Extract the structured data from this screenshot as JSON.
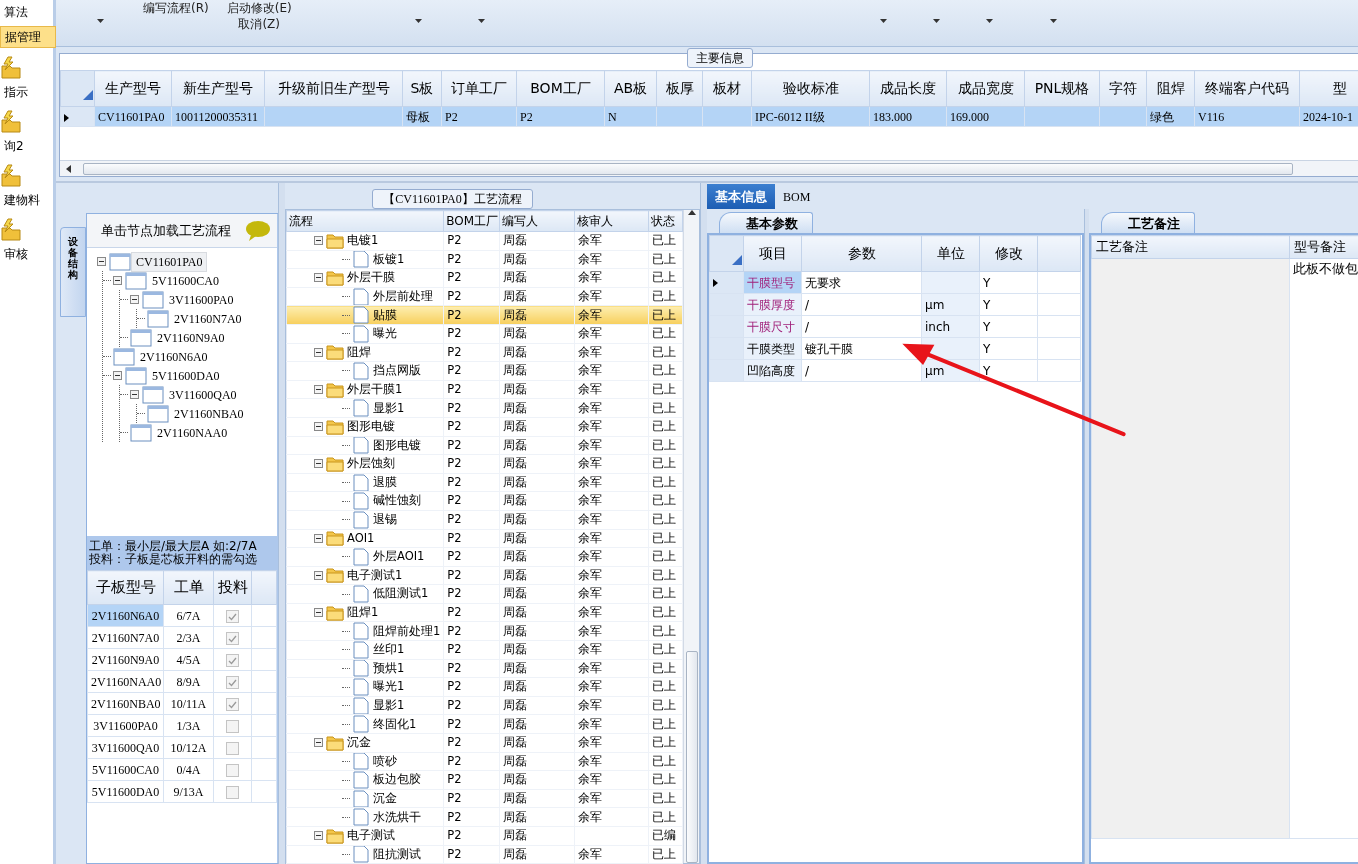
{
  "nav": [
    {
      "label": "算法",
      "kind": "text",
      "selected": false
    },
    {
      "label": "据管理",
      "kind": "text",
      "selected": true
    },
    {
      "label": "指示",
      "kind": "icon",
      "selected": false
    },
    {
      "label": "询2",
      "kind": "icon",
      "selected": false
    },
    {
      "label": "建物料",
      "kind": "icon",
      "selected": false
    },
    {
      "label": "审核",
      "kind": "icon",
      "selected": false
    }
  ],
  "toolbar": {
    "buttons": [
      {
        "label": "编写流程(R)"
      },
      {
        "label": "启动修改(E)"
      },
      {
        "label": "取消(Z)"
      }
    ]
  },
  "main_info": {
    "title": "主要信息",
    "columns": [
      "生产型号",
      "新生产型号",
      "升级前旧生产型号",
      "S板",
      "订单工厂",
      "BOM工厂",
      "AB板",
      "板厚",
      "板材",
      "验收标准",
      "成品长度",
      "成品宽度",
      "PNL规格",
      "字符",
      "阻焊",
      "终端客户代码",
      "型"
    ],
    "rows": [
      {
        "selected": true,
        "cells": [
          "CV11601PA0",
          "10011200035311",
          null,
          "母板",
          "P2",
          "P2",
          "N",
          null,
          null,
          "IPC-6012 II级",
          "183.000",
          "169.000",
          null,
          null,
          "绿色",
          "V116",
          "2024-10-1"
        ]
      }
    ]
  },
  "structure": {
    "side_tab": "设备结构",
    "hint": "单击节点加载工艺流程",
    "tree": [
      {
        "label": "CV11601PA0",
        "selected": true,
        "expanded": true,
        "children": [
          {
            "label": "5V11600CA0",
            "selected": false,
            "expanded": true,
            "children": [
              {
                "label": "3V11600PA0",
                "selected": false,
                "expanded": true,
                "children": [
                  {
                    "label": "2V1160N7A0",
                    "selected": false
                  }
                ]
              },
              {
                "label": "2V1160N9A0",
                "selected": false
              }
            ]
          },
          {
            "label": "2V1160N6A0",
            "selected": false
          },
          {
            "label": "5V11600DA0",
            "selected": false,
            "expanded": true,
            "children": [
              {
                "label": "3V11600QA0",
                "selected": false,
                "expanded": true,
                "children": [
                  {
                    "label": "2V1160NBA0",
                    "selected": false
                  }
                ]
              },
              {
                "label": "2V1160NAA0",
                "selected": false
              }
            ]
          }
        ]
      }
    ],
    "notes": [
      "工单：最小层/最大层A 如:2/7A",
      "投料：子板是芯板开料的需勾选"
    ],
    "columns": [
      "子板型号",
      "工单",
      "投料"
    ],
    "rows": [
      {
        "model": "2V1160N6A0",
        "order": "6/7A",
        "feed": true,
        "selected": true
      },
      {
        "model": "2V1160N7A0",
        "order": "2/3A",
        "feed": true,
        "selected": false
      },
      {
        "model": "2V1160N9A0",
        "order": "4/5A",
        "feed": true,
        "selected": false
      },
      {
        "model": "2V1160NAA0",
        "order": "8/9A",
        "feed": true,
        "selected": false
      },
      {
        "model": "2V1160NBA0",
        "order": "10/11A",
        "feed": true,
        "selected": false
      },
      {
        "model": "3V11600PA0",
        "order": "1/3A",
        "feed": false,
        "selected": false
      },
      {
        "model": "3V11600QA0",
        "order": "10/12A",
        "feed": false,
        "selected": false
      },
      {
        "model": "5V11600CA0",
        "order": "0/4A",
        "feed": false,
        "selected": false
      },
      {
        "model": "5V11600DA0",
        "order": "9/13A",
        "feed": false,
        "selected": false
      }
    ]
  },
  "flow": {
    "title": "【CV11601PA0】工艺流程",
    "columns": [
      "流程",
      "BOM工厂",
      "编写人",
      "核审人",
      "状态"
    ],
    "steps": [
      {
        "name": "电镀1",
        "bom": "P2",
        "writer": "周磊",
        "reviewer": "余军",
        "status": "已上",
        "selected": false,
        "children": [
          {
            "name": "板镀1",
            "bom": "P2",
            "writer": "周磊",
            "reviewer": "余军",
            "status": "已上",
            "selected": false
          }
        ]
      },
      {
        "name": "外层干膜",
        "bom": "P2",
        "writer": "周磊",
        "reviewer": "余军",
        "status": "已上",
        "selected": false,
        "children": [
          {
            "name": "外层前处理",
            "bom": "P2",
            "writer": "周磊",
            "reviewer": "余军",
            "status": "已上",
            "selected": false
          },
          {
            "name": "贴膜",
            "bom": "P2",
            "writer": "周磊",
            "reviewer": "余军",
            "status": "已上",
            "selected": true
          },
          {
            "name": "曝光",
            "bom": "P2",
            "writer": "周磊",
            "reviewer": "余军",
            "status": "已上",
            "selected": false
          }
        ]
      },
      {
        "name": "阻焊",
        "bom": "P2",
        "writer": "周磊",
        "reviewer": "余军",
        "status": "已上",
        "selected": false,
        "children": [
          {
            "name": "挡点网版",
            "bom": "P2",
            "writer": "周磊",
            "reviewer": "余军",
            "status": "已上",
            "selected": false
          }
        ]
      },
      {
        "name": "外层干膜1",
        "bom": "P2",
        "writer": "周磊",
        "reviewer": "余军",
        "status": "已上",
        "selected": false,
        "children": [
          {
            "name": "显影1",
            "bom": "P2",
            "writer": "周磊",
            "reviewer": "余军",
            "status": "已上",
            "selected": false
          }
        ]
      },
      {
        "name": "图形电镀",
        "bom": "P2",
        "writer": "周磊",
        "reviewer": "余军",
        "status": "已上",
        "selected": false,
        "children": [
          {
            "name": "图形电镀",
            "bom": "P2",
            "writer": "周磊",
            "reviewer": "余军",
            "status": "已上",
            "selected": false
          }
        ]
      },
      {
        "name": "外层蚀刻",
        "bom": "P2",
        "writer": "周磊",
        "reviewer": "余军",
        "status": "已上",
        "selected": false,
        "children": [
          {
            "name": "退膜",
            "bom": "P2",
            "writer": "周磊",
            "reviewer": "余军",
            "status": "已上",
            "selected": false
          },
          {
            "name": "碱性蚀刻",
            "bom": "P2",
            "writer": "周磊",
            "reviewer": "余军",
            "status": "已上",
            "selected": false
          },
          {
            "name": "退锡",
            "bom": "P2",
            "writer": "周磊",
            "reviewer": "余军",
            "status": "已上",
            "selected": false
          }
        ]
      },
      {
        "name": "AOI1",
        "bom": "P2",
        "writer": "周磊",
        "reviewer": "余军",
        "status": "已上",
        "selected": false,
        "children": [
          {
            "name": "外层AOI1",
            "bom": "P2",
            "writer": "周磊",
            "reviewer": "余军",
            "status": "已上",
            "selected": false
          }
        ]
      },
      {
        "name": "电子测试1",
        "bom": "P2",
        "writer": "周磊",
        "reviewer": "余军",
        "status": "已上",
        "selected": false,
        "children": [
          {
            "name": "低阻测试1",
            "bom": "P2",
            "writer": "周磊",
            "reviewer": "余军",
            "status": "已上",
            "selected": false
          }
        ]
      },
      {
        "name": "阻焊1",
        "bom": "P2",
        "writer": "周磊",
        "reviewer": "余军",
        "status": "已上",
        "selected": false,
        "children": [
          {
            "name": "阻焊前处理1",
            "bom": "P2",
            "writer": "周磊",
            "reviewer": "余军",
            "status": "已上",
            "selected": false
          },
          {
            "name": "丝印1",
            "bom": "P2",
            "writer": "周磊",
            "reviewer": "余军",
            "status": "已上",
            "selected": false
          },
          {
            "name": "预烘1",
            "bom": "P2",
            "writer": "周磊",
            "reviewer": "余军",
            "status": "已上",
            "selected": false
          },
          {
            "name": "曝光1",
            "bom": "P2",
            "writer": "周磊",
            "reviewer": "余军",
            "status": "已上",
            "selected": false
          },
          {
            "name": "显影1",
            "bom": "P2",
            "writer": "周磊",
            "reviewer": "余军",
            "status": "已上",
            "selected": false
          },
          {
            "name": "终固化1",
            "bom": "P2",
            "writer": "周磊",
            "reviewer": "余军",
            "status": "已上",
            "selected": false
          }
        ]
      },
      {
        "name": "沉金",
        "bom": "P2",
        "writer": "周磊",
        "reviewer": "余军",
        "status": "已上",
        "selected": false,
        "children": [
          {
            "name": "喷砂",
            "bom": "P2",
            "writer": "周磊",
            "reviewer": "余军",
            "status": "已上",
            "selected": false
          },
          {
            "name": "板边包胶",
            "bom": "P2",
            "writer": "周磊",
            "reviewer": "余军",
            "status": "已上",
            "selected": false
          },
          {
            "name": "沉金",
            "bom": "P2",
            "writer": "周磊",
            "reviewer": "余军",
            "status": "已上",
            "selected": false
          },
          {
            "name": "水洗烘干",
            "bom": "P2",
            "writer": "周磊",
            "reviewer": "余军",
            "status": "已上",
            "selected": false
          }
        ]
      },
      {
        "name": "电子测试",
        "bom": "P2",
        "writer": "周磊",
        "status": "已编",
        "selected": false,
        "children": [
          {
            "name": "阻抗测试",
            "bom": "P2",
            "writer": "周磊",
            "reviewer": "余军",
            "status": "已上",
            "selected": false
          }
        ]
      }
    ]
  },
  "detail": {
    "tabs": [
      {
        "label": "基本信息",
        "selected": true
      },
      {
        "label": "BOM",
        "selected": false
      }
    ],
    "params": {
      "tab": "基本参数",
      "columns": [
        "项目",
        "参数",
        "单位",
        "修改"
      ],
      "rows": [
        {
          "item": "干膜型号",
          "value": "无要求",
          "modify": "Y",
          "required": true,
          "selected": true
        },
        {
          "item": "干膜厚度",
          "value": "/",
          "unit": "μm",
          "modify": "Y",
          "required": true,
          "selected": false
        },
        {
          "item": "干膜尺寸",
          "value": "/",
          "unit": "inch",
          "modify": "Y",
          "required": true,
          "selected": false
        },
        {
          "item": "干膜类型",
          "value": "镀孔干膜",
          "modify": "Y",
          "required": false,
          "selected": false
        },
        {
          "item": "凹陷高度",
          "value": "/",
          "unit": "μm",
          "modify": "Y",
          "required": false,
          "selected": false
        }
      ]
    },
    "notes": {
      "tab": "工艺备注",
      "columns": [
        "工艺备注",
        "型号备注"
      ],
      "cells": [
        null,
        "此板不做包"
      ]
    }
  }
}
